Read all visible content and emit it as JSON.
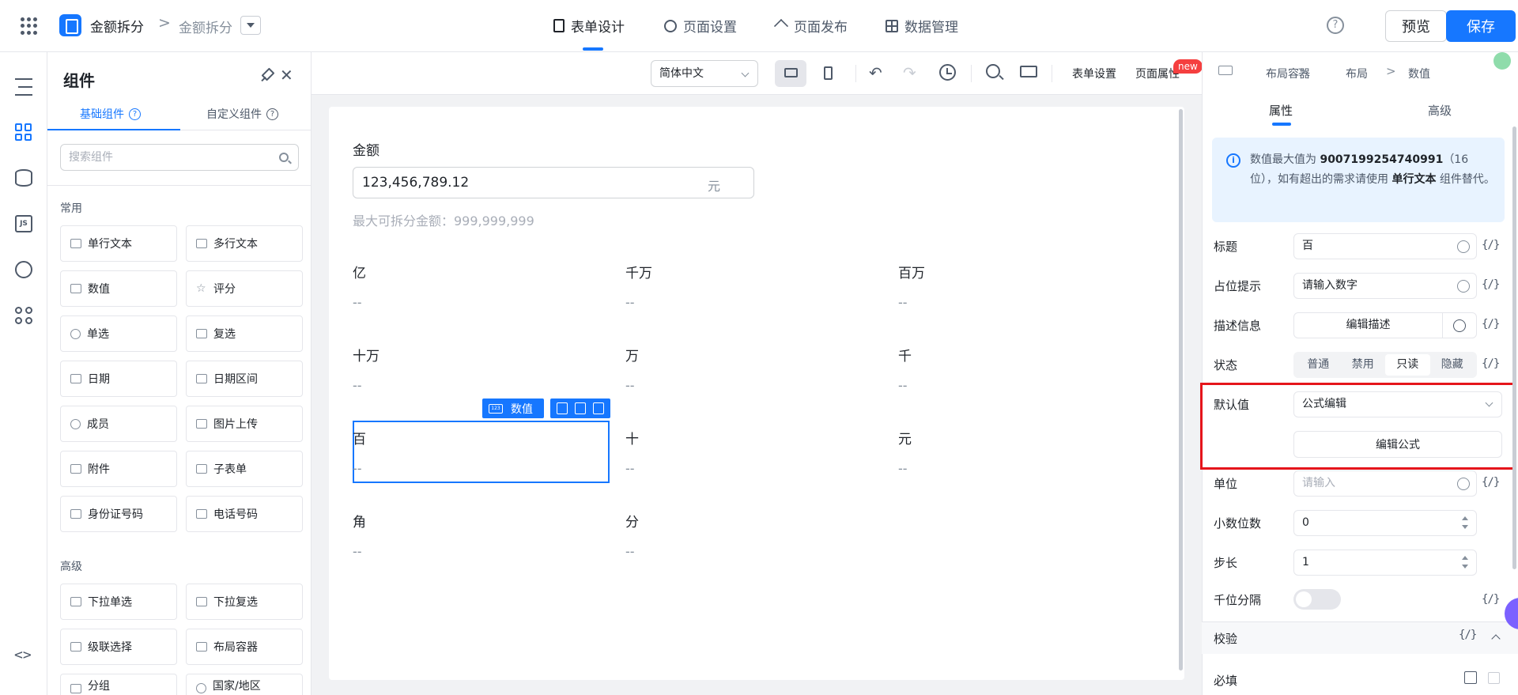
{
  "header": {
    "app_name": "金额拆分",
    "breadcrumb_page": "金额拆分",
    "nav_tabs": [
      {
        "label": "表单设计",
        "icon": "form-doc-icon"
      },
      {
        "label": "页面设置",
        "icon": "gear-icon"
      },
      {
        "label": "页面发布",
        "icon": "send-icon"
      },
      {
        "label": "数据管理",
        "icon": "table-icon"
      }
    ],
    "help_glyph": "?",
    "preview_label": "预览",
    "save_label": "保存",
    "accent_color": "#1677ff"
  },
  "rail": {
    "icons": [
      "outline-icon",
      "components-icon",
      "datasource-icon",
      "js-icon",
      "globe-icon",
      "apps-icon"
    ],
    "js_text": "JS",
    "code_text": "<>"
  },
  "components_panel": {
    "title": "组件",
    "tabs": [
      {
        "label": "基础组件"
      },
      {
        "label": "自定义组件"
      }
    ],
    "search_placeholder": "搜索组件",
    "groups": [
      {
        "title": "常用",
        "items": [
          {
            "label": "单行文本",
            "icon": "input-icon"
          },
          {
            "label": "多行文本",
            "icon": "textarea-icon"
          },
          {
            "label": "数值",
            "icon": "number-icon"
          },
          {
            "label": "评分",
            "icon": "star-icon"
          },
          {
            "label": "单选",
            "icon": "radio-icon"
          },
          {
            "label": "复选",
            "icon": "checkbox-icon"
          },
          {
            "label": "日期",
            "icon": "calendar-icon"
          },
          {
            "label": "日期区间",
            "icon": "date-range-icon"
          },
          {
            "label": "成员",
            "icon": "user-icon"
          },
          {
            "label": "图片上传",
            "icon": "image-icon"
          },
          {
            "label": "附件",
            "icon": "attachment-icon"
          },
          {
            "label": "子表单",
            "icon": "subform-icon"
          },
          {
            "label": "身份证号码",
            "icon": "id-card-icon"
          },
          {
            "label": "电话号码",
            "icon": "phone-icon"
          }
        ]
      },
      {
        "title": "高级",
        "items": [
          {
            "label": "下拉单选",
            "icon": "select-icon"
          },
          {
            "label": "下拉复选",
            "icon": "multi-select-icon"
          },
          {
            "label": "级联选择",
            "icon": "cascader-icon"
          },
          {
            "label": "布局容器",
            "icon": "layout-icon"
          },
          {
            "label": "分组",
            "icon": "group-icon"
          },
          {
            "label": "国家/地区",
            "icon": "region-icon"
          }
        ]
      }
    ]
  },
  "toolbar": {
    "language": "简体中文",
    "undo_glyph": "↶",
    "redo_glyph": "↷",
    "form_settings": "表单设置",
    "page_props": "页面属性",
    "new_badge": "new"
  },
  "canvas": {
    "amount_label": "金额",
    "amount_value": "123,456,789.12",
    "amount_unit": "元",
    "amount_desc": "最大可拆分金额：999,999,999",
    "digits": [
      {
        "label": "亿",
        "value": "--"
      },
      {
        "label": "千万",
        "value": "--"
      },
      {
        "label": "百万",
        "value": "--"
      },
      {
        "label": "十万",
        "value": "--"
      },
      {
        "label": "万",
        "value": "--"
      },
      {
        "label": "千",
        "value": "--"
      },
      {
        "label": "百",
        "value": "--"
      },
      {
        "label": "十",
        "value": "--"
      },
      {
        "label": "元",
        "value": "--"
      },
      {
        "label": "角",
        "value": "--"
      },
      {
        "label": "分",
        "value": "--"
      }
    ],
    "selected_tag": "数值",
    "selected_tag_icon_text": "123"
  },
  "props_panel": {
    "breadcrumb": [
      "布局容器",
      "布局",
      "数值"
    ],
    "breadcrumb_sep": ">",
    "tabs": [
      "属性",
      "高级"
    ],
    "info": {
      "prefix": "数值最大值为",
      "max_value": "9007199254740991",
      "middle": "（16位），如有超出的需求请使用",
      "alt_component": "单行文本",
      "suffix": "组件替代。",
      "icon_glyph": "i"
    },
    "fx_glyph": "{/}",
    "title_label": "标题",
    "title_value": "百",
    "placeholder_label": "占位提示",
    "placeholder_value": "请输入数字",
    "desc_label": "描述信息",
    "desc_button": "编辑描述",
    "status_label": "状态",
    "status_options": [
      "普通",
      "禁用",
      "只读",
      "隐藏"
    ],
    "status_selected": "只读",
    "default_label": "默认值",
    "default_mode": "公式编辑",
    "edit_formula_button": "编辑公式",
    "unit_label": "单位",
    "unit_placeholder": "请输入",
    "decimals_label": "小数位数",
    "decimals_value": "0",
    "step_label": "步长",
    "step_value": "1",
    "thousands_label": "千位分隔",
    "thousands_on": false,
    "validation_title": "校验",
    "required_label": "必填",
    "highlight_color": "#e5151b"
  }
}
